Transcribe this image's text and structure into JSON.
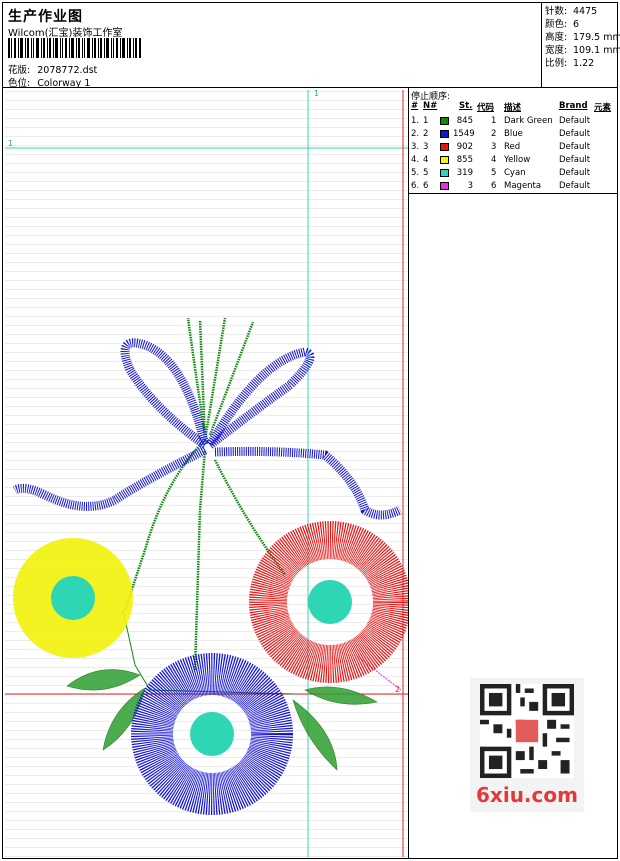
{
  "header": {
    "title": "生产作业图",
    "company": "Wilcom(汇宝)装饰工作室",
    "design_label": "花版:",
    "design_value": "2078772.dst",
    "colorway_label": "色位:",
    "colorway_value": "Colorway 1"
  },
  "stats": [
    {
      "label": "针数:",
      "value": "4475"
    },
    {
      "label": "颜色:",
      "value": "6"
    },
    {
      "label": "高度:",
      "value": "179.5 mm"
    },
    {
      "label": "宽度:",
      "value": "109.1 mm"
    },
    {
      "label": "比例:",
      "value": "1.22"
    }
  ],
  "stop_sequence": {
    "title": "停止顺序:",
    "headers": {
      "num": "#",
      "n": "N#",
      "st": "St.",
      "code": "代码",
      "desc": "描述",
      "brand": "Brand",
      "elem": "元素"
    },
    "rows": [
      {
        "num": "1.",
        "n": "1",
        "color": "#0a8a0a",
        "st": "845",
        "code": "1",
        "desc": "Dark Green",
        "brand": "Default"
      },
      {
        "num": "2.",
        "n": "2",
        "color": "#1414d6",
        "st": "1549",
        "code": "2",
        "desc": "Blue",
        "brand": "Default"
      },
      {
        "num": "3.",
        "n": "3",
        "color": "#e61414",
        "st": "902",
        "code": "3",
        "desc": "Red",
        "brand": "Default"
      },
      {
        "num": "4.",
        "n": "4",
        "color": "#f2f20a",
        "st": "855",
        "code": "4",
        "desc": "Yellow",
        "brand": "Default"
      },
      {
        "num": "5.",
        "n": "5",
        "color": "#2fd6b4",
        "st": "319",
        "code": "5",
        "desc": "Cyan",
        "brand": "Default"
      },
      {
        "num": "6.",
        "n": "6",
        "color": "#e62ee6",
        "st": "3",
        "code": "6",
        "desc": "Magenta",
        "brand": "Default"
      }
    ]
  },
  "canvas": {
    "marker_v_top": "1",
    "marker_h_left": "1",
    "marker_h2_right": "2"
  },
  "watermark": {
    "text": "6xiu.com"
  }
}
